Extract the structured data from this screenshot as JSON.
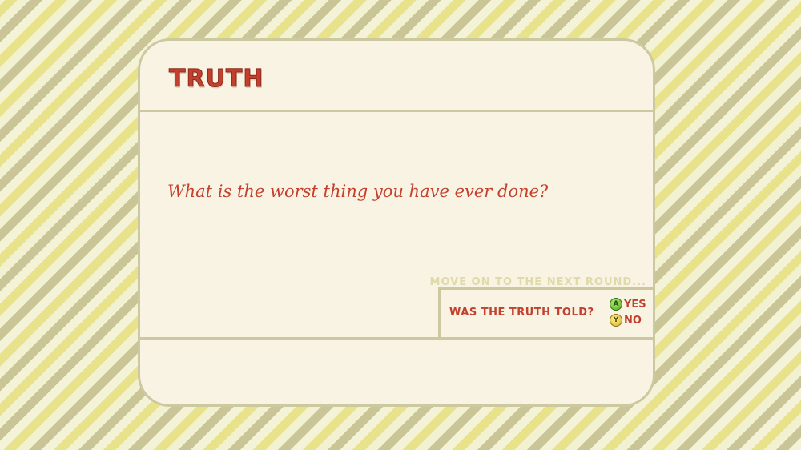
{
  "card": {
    "title": "TRUTH",
    "question": "What is the worst thing you have ever done?",
    "next_round_label": "MOVE ON TO THE NEXT ROUND...",
    "confirm_question": "WAS THE TRUTH TOLD?",
    "options": [
      {
        "button": "A",
        "icon": "a-button-icon",
        "label": "YES",
        "color": "#5cb82a"
      },
      {
        "button": "Y",
        "icon": "y-button-icon",
        "label": "NO",
        "color": "#e6c22a"
      }
    ]
  },
  "colors": {
    "accent": "#c4402e",
    "card_bg": "#f8f3e2",
    "border": "#ccc8a0",
    "muted_text": "#e0d9a8"
  }
}
